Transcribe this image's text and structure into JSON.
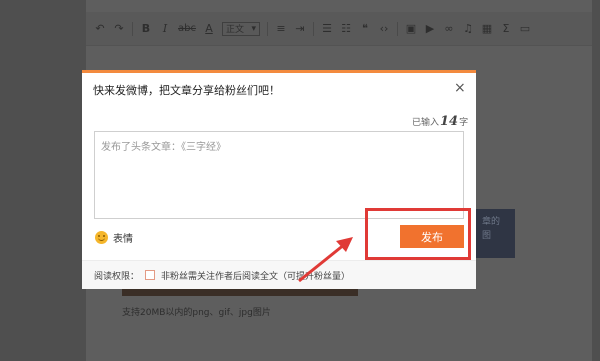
{
  "toolbar": {
    "icons": [
      "undo-icon",
      "redo-icon",
      "bold-icon",
      "italic-icon",
      "strikethrough-icon",
      "font-color-icon",
      "align-icon",
      "indent-icon",
      "list-icon",
      "ordered-list-icon",
      "quote-icon",
      "code-icon",
      "image-icon",
      "video-icon",
      "link-icon",
      "music-icon",
      "grid-icon",
      "formula-icon",
      "more-icon"
    ],
    "bold": "B",
    "italic": "I",
    "strike": "abc",
    "font_color": "A",
    "style_select": "正文"
  },
  "image_caption": "支持20MB以内的png、gif、jpg图片",
  "side_tooltip": {
    "line1": "章的",
    "line2": "图"
  },
  "dialog": {
    "title": "快来发微博，把文章分享给粉丝们吧！",
    "close": "×",
    "counter_prefix": "已输入",
    "counter_value": "14",
    "counter_suffix": "字",
    "text": "发布了头条文章：《三字经》",
    "emoji_label": "表情",
    "publish_label": "发布",
    "footer_label": "阅读权限：",
    "footer_option": "非粉丝需关注作者后阅读全文（可提升粉丝量）"
  },
  "colors": {
    "accent": "#f38a3e",
    "publish": "#f1722e",
    "highlight": "#e03a36"
  }
}
